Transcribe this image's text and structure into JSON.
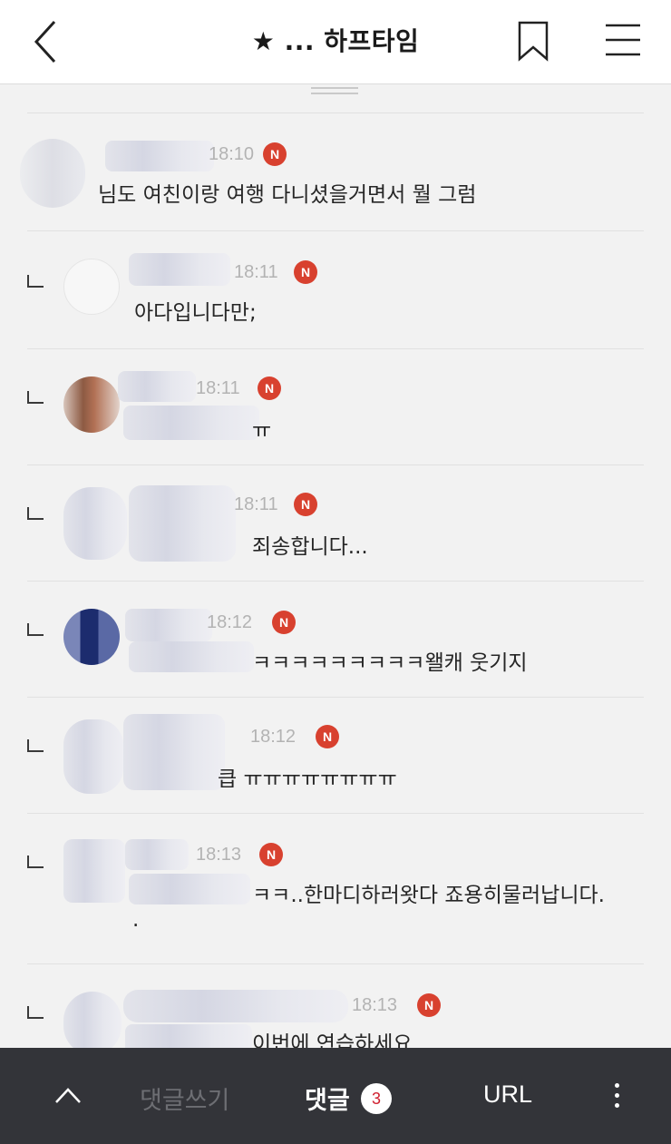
{
  "header": {
    "title": "★ ... 하프타임",
    "back_icon": "chevron-left-icon",
    "bookmark_icon": "bookmark-icon",
    "menu_icon": "hamburger-menu-icon"
  },
  "comments": [
    {
      "time": "18:10",
      "badge": "N",
      "text": "님도 여친이랑 여행 다니셨을거면서 뭘 그럼",
      "reply": false
    },
    {
      "time": "18:11",
      "badge": "N",
      "text": "아다입니다만;",
      "reply": true
    },
    {
      "time": "18:11",
      "badge": "N",
      "text": "ㅠ",
      "reply": true
    },
    {
      "time": "18:11",
      "badge": "N",
      "text": "죄송합니다...",
      "reply": true
    },
    {
      "time": "18:12",
      "badge": "N",
      "text": "ㅋㅋㅋㅋㅋㅋㅋㅋㅋ왤캐 웃기지",
      "reply": true
    },
    {
      "time": "18:12",
      "badge": "N",
      "text": "큽 ㅠㅠㅠㅠㅠㅠㅠㅠ",
      "reply": true
    },
    {
      "time": "18:13",
      "badge": "N",
      "text": "ㅋㅋ..한마디하러왓다 죠용히물러납니다.",
      "text2": ".",
      "reply": true
    },
    {
      "time": "18:13",
      "badge": "N",
      "text": "이번에 연습하세요",
      "reply": true
    }
  ],
  "bottom_bar": {
    "up_icon": "chevron-up-icon",
    "write_label": "댓글쓰기",
    "comments_label": "댓글",
    "comments_count": "3",
    "url_label": "URL",
    "more_icon": "vertical-dots-icon"
  },
  "colors": {
    "badge": "#d8412f",
    "bottom_bar": "#333439",
    "count_text": "#d0202f"
  }
}
